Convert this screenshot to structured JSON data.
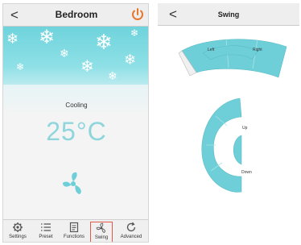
{
  "left_screen": {
    "title": "Bedroom",
    "back_glyph": "<",
    "power_icon": "power-icon",
    "mode": "Cooling",
    "temperature": "25°C",
    "accent_color": "#8fd6dc",
    "power_color": "#e8772e",
    "tabs": [
      {
        "label": "Settings",
        "icon": "gear-icon"
      },
      {
        "label": "Preset",
        "icon": "list-icon"
      },
      {
        "label": "Functions",
        "icon": "document-icon"
      },
      {
        "label": "Swing",
        "icon": "fan-icon",
        "selected": true
      },
      {
        "label": "Advanced",
        "icon": "refresh-icon"
      }
    ]
  },
  "right_screen": {
    "title": "Swing",
    "back_glyph": "<",
    "horizontal_swing": {
      "left_label": "Left",
      "right_label": "Right"
    },
    "vertical_swing": {
      "up_label": "Up",
      "down_label": "Down"
    },
    "swing_color": "#6ecfd8"
  }
}
